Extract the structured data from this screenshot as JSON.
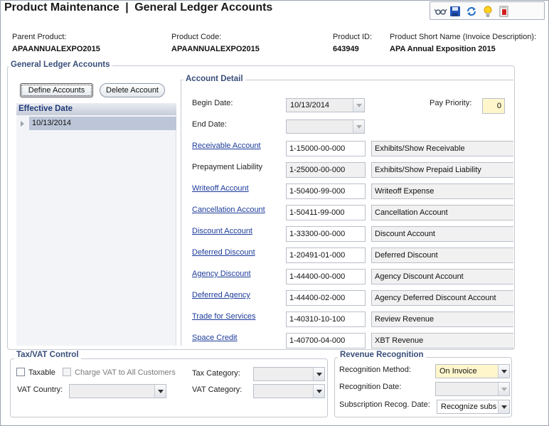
{
  "title": {
    "main": "Product Maintenance",
    "separator": "|",
    "sub": "General Ledger Accounts"
  },
  "toolbar": {
    "icons": [
      "glasses-icon",
      "save-icon",
      "refresh-icon",
      "lightbulb-icon",
      "report-icon"
    ]
  },
  "header": {
    "parent_product": {
      "label": "Parent Product:",
      "value": "APAANNUALEXPO2015"
    },
    "product_code": {
      "label": "Product Code:",
      "value": "APAANNUALEXPO2015"
    },
    "product_id": {
      "label": "Product ID:",
      "value": "643949"
    },
    "short_name": {
      "label": "Product Short Name (Invoice Description):",
      "value": "APA Annual Exposition 2015"
    }
  },
  "gl_section": {
    "legend": "General Ledger Accounts",
    "define_button": "Define Accounts",
    "delete_button": "Delete Account",
    "tree_header": "Effective Date",
    "tree_row": "10/13/2014"
  },
  "account_detail": {
    "legend": "Account Detail",
    "begin_date_label": "Begin Date:",
    "begin_date_value": "10/13/2014",
    "end_date_label": "End Date:",
    "end_date_value": "",
    "pay_priority_label": "Pay Priority:",
    "pay_priority_value": "0",
    "rows": [
      {
        "label": "Receivable Account",
        "code": "1-15000-00-000",
        "desc": "Exhibits/Show Receivable"
      },
      {
        "label": "Prepayment Liability",
        "code": "1-25000-00-000",
        "desc": "Exhibits/Show Prepaid Liability"
      },
      {
        "label": "Writeoff Account",
        "code": "1-50400-99-000",
        "desc": "Writeoff Expense"
      },
      {
        "label": "Cancellation Account",
        "code": "1-50411-99-000",
        "desc": "Cancellation Account"
      },
      {
        "label": "Discount Account",
        "code": "1-33300-00-000",
        "desc": "Discount Account"
      },
      {
        "label": "Deferred Discount",
        "code": "1-20491-01-000",
        "desc": "Deferred Discount"
      },
      {
        "label": "Agency Discount",
        "code": "1-44400-00-000",
        "desc": "Agency Discount Account"
      },
      {
        "label": "Deferred Agency",
        "code": "1-44400-02-000",
        "desc": "Agency Deferred Discount Account"
      },
      {
        "label": "Trade for Services",
        "code": "1-40310-10-100",
        "desc": "Review Revenue"
      },
      {
        "label": "Space Credit",
        "code": "1-40700-04-000",
        "desc": "XBT Revenue"
      }
    ]
  },
  "tax": {
    "legend": "Tax/VAT Control",
    "taxable_label": "Taxable",
    "charge_vat_label": "Charge VAT to All Customers",
    "vat_country_label": "VAT Country:",
    "vat_country_value": "",
    "tax_category_label": "Tax Category:",
    "tax_category_value": "",
    "vat_category_label": "VAT Category:",
    "vat_category_value": ""
  },
  "revenue": {
    "legend": "Revenue Recognition",
    "method_label": "Recognition Method:",
    "method_value": "On Invoice",
    "date_label": "Recognition Date:",
    "date_value": "",
    "sub_label": "Subscription Recog. Date:",
    "sub_value": "Recognize subs"
  },
  "colors": {
    "link": "#1d3c9a",
    "legend": "#3a4f7a",
    "tree_selected": "#bcc6d8",
    "priority_bg": "#fff6cc"
  }
}
